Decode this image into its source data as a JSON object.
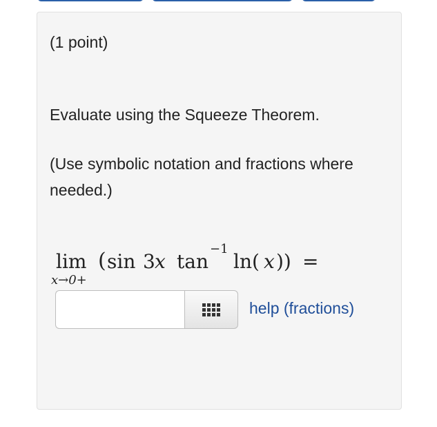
{
  "problem": {
    "points": "(1 point)",
    "instruction": "Evaluate using the Squeeze Theorem.",
    "note": "(Use symbolic notation and fractions where needed.)"
  },
  "math": {
    "lim": "lim",
    "limit_sub": "x→0+",
    "open_paren": "(",
    "sin": "sin",
    "three": "3",
    "x": "x",
    "tan": "tan",
    "exponent": "−1",
    "ln": "ln(",
    "ln_arg": "x",
    "close_parens": "))",
    "equals": "="
  },
  "answer": {
    "value": "",
    "help_link": "help (fractions)",
    "palette_icon": "grid-icon"
  }
}
